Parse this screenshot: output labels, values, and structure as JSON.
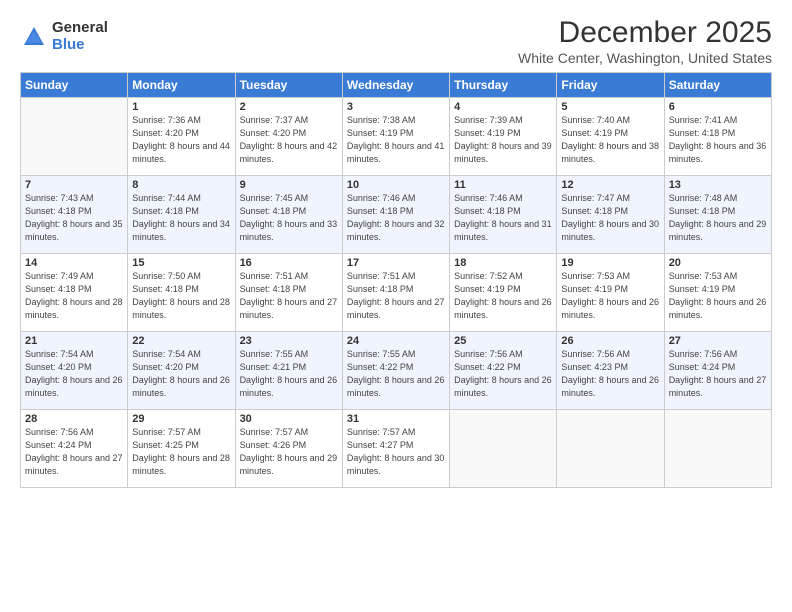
{
  "logo": {
    "general": "General",
    "blue": "Blue"
  },
  "title": "December 2025",
  "subtitle": "White Center, Washington, United States",
  "days_of_week": [
    "Sunday",
    "Monday",
    "Tuesday",
    "Wednesday",
    "Thursday",
    "Friday",
    "Saturday"
  ],
  "weeks": [
    [
      {
        "day": "",
        "sunrise": "",
        "sunset": "",
        "daylight": "",
        "empty": true
      },
      {
        "day": "1",
        "sunrise": "Sunrise: 7:36 AM",
        "sunset": "Sunset: 4:20 PM",
        "daylight": "Daylight: 8 hours and 44 minutes."
      },
      {
        "day": "2",
        "sunrise": "Sunrise: 7:37 AM",
        "sunset": "Sunset: 4:20 PM",
        "daylight": "Daylight: 8 hours and 42 minutes."
      },
      {
        "day": "3",
        "sunrise": "Sunrise: 7:38 AM",
        "sunset": "Sunset: 4:19 PM",
        "daylight": "Daylight: 8 hours and 41 minutes."
      },
      {
        "day": "4",
        "sunrise": "Sunrise: 7:39 AM",
        "sunset": "Sunset: 4:19 PM",
        "daylight": "Daylight: 8 hours and 39 minutes."
      },
      {
        "day": "5",
        "sunrise": "Sunrise: 7:40 AM",
        "sunset": "Sunset: 4:19 PM",
        "daylight": "Daylight: 8 hours and 38 minutes."
      },
      {
        "day": "6",
        "sunrise": "Sunrise: 7:41 AM",
        "sunset": "Sunset: 4:18 PM",
        "daylight": "Daylight: 8 hours and 36 minutes."
      }
    ],
    [
      {
        "day": "7",
        "sunrise": "Sunrise: 7:43 AM",
        "sunset": "Sunset: 4:18 PM",
        "daylight": "Daylight: 8 hours and 35 minutes."
      },
      {
        "day": "8",
        "sunrise": "Sunrise: 7:44 AM",
        "sunset": "Sunset: 4:18 PM",
        "daylight": "Daylight: 8 hours and 34 minutes."
      },
      {
        "day": "9",
        "sunrise": "Sunrise: 7:45 AM",
        "sunset": "Sunset: 4:18 PM",
        "daylight": "Daylight: 8 hours and 33 minutes."
      },
      {
        "day": "10",
        "sunrise": "Sunrise: 7:46 AM",
        "sunset": "Sunset: 4:18 PM",
        "daylight": "Daylight: 8 hours and 32 minutes."
      },
      {
        "day": "11",
        "sunrise": "Sunrise: 7:46 AM",
        "sunset": "Sunset: 4:18 PM",
        "daylight": "Daylight: 8 hours and 31 minutes."
      },
      {
        "day": "12",
        "sunrise": "Sunrise: 7:47 AM",
        "sunset": "Sunset: 4:18 PM",
        "daylight": "Daylight: 8 hours and 30 minutes."
      },
      {
        "day": "13",
        "sunrise": "Sunrise: 7:48 AM",
        "sunset": "Sunset: 4:18 PM",
        "daylight": "Daylight: 8 hours and 29 minutes."
      }
    ],
    [
      {
        "day": "14",
        "sunrise": "Sunrise: 7:49 AM",
        "sunset": "Sunset: 4:18 PM",
        "daylight": "Daylight: 8 hours and 28 minutes."
      },
      {
        "day": "15",
        "sunrise": "Sunrise: 7:50 AM",
        "sunset": "Sunset: 4:18 PM",
        "daylight": "Daylight: 8 hours and 28 minutes."
      },
      {
        "day": "16",
        "sunrise": "Sunrise: 7:51 AM",
        "sunset": "Sunset: 4:18 PM",
        "daylight": "Daylight: 8 hours and 27 minutes."
      },
      {
        "day": "17",
        "sunrise": "Sunrise: 7:51 AM",
        "sunset": "Sunset: 4:18 PM",
        "daylight": "Daylight: 8 hours and 27 minutes."
      },
      {
        "day": "18",
        "sunrise": "Sunrise: 7:52 AM",
        "sunset": "Sunset: 4:19 PM",
        "daylight": "Daylight: 8 hours and 26 minutes."
      },
      {
        "day": "19",
        "sunrise": "Sunrise: 7:53 AM",
        "sunset": "Sunset: 4:19 PM",
        "daylight": "Daylight: 8 hours and 26 minutes."
      },
      {
        "day": "20",
        "sunrise": "Sunrise: 7:53 AM",
        "sunset": "Sunset: 4:19 PM",
        "daylight": "Daylight: 8 hours and 26 minutes."
      }
    ],
    [
      {
        "day": "21",
        "sunrise": "Sunrise: 7:54 AM",
        "sunset": "Sunset: 4:20 PM",
        "daylight": "Daylight: 8 hours and 26 minutes."
      },
      {
        "day": "22",
        "sunrise": "Sunrise: 7:54 AM",
        "sunset": "Sunset: 4:20 PM",
        "daylight": "Daylight: 8 hours and 26 minutes."
      },
      {
        "day": "23",
        "sunrise": "Sunrise: 7:55 AM",
        "sunset": "Sunset: 4:21 PM",
        "daylight": "Daylight: 8 hours and 26 minutes."
      },
      {
        "day": "24",
        "sunrise": "Sunrise: 7:55 AM",
        "sunset": "Sunset: 4:22 PM",
        "daylight": "Daylight: 8 hours and 26 minutes."
      },
      {
        "day": "25",
        "sunrise": "Sunrise: 7:56 AM",
        "sunset": "Sunset: 4:22 PM",
        "daylight": "Daylight: 8 hours and 26 minutes."
      },
      {
        "day": "26",
        "sunrise": "Sunrise: 7:56 AM",
        "sunset": "Sunset: 4:23 PM",
        "daylight": "Daylight: 8 hours and 26 minutes."
      },
      {
        "day": "27",
        "sunrise": "Sunrise: 7:56 AM",
        "sunset": "Sunset: 4:24 PM",
        "daylight": "Daylight: 8 hours and 27 minutes."
      }
    ],
    [
      {
        "day": "28",
        "sunrise": "Sunrise: 7:56 AM",
        "sunset": "Sunset: 4:24 PM",
        "daylight": "Daylight: 8 hours and 27 minutes."
      },
      {
        "day": "29",
        "sunrise": "Sunrise: 7:57 AM",
        "sunset": "Sunset: 4:25 PM",
        "daylight": "Daylight: 8 hours and 28 minutes."
      },
      {
        "day": "30",
        "sunrise": "Sunrise: 7:57 AM",
        "sunset": "Sunset: 4:26 PM",
        "daylight": "Daylight: 8 hours and 29 minutes."
      },
      {
        "day": "31",
        "sunrise": "Sunrise: 7:57 AM",
        "sunset": "Sunset: 4:27 PM",
        "daylight": "Daylight: 8 hours and 30 minutes."
      },
      {
        "day": "",
        "sunrise": "",
        "sunset": "",
        "daylight": "",
        "empty": true
      },
      {
        "day": "",
        "sunrise": "",
        "sunset": "",
        "daylight": "",
        "empty": true
      },
      {
        "day": "",
        "sunrise": "",
        "sunset": "",
        "daylight": "",
        "empty": true
      }
    ]
  ]
}
